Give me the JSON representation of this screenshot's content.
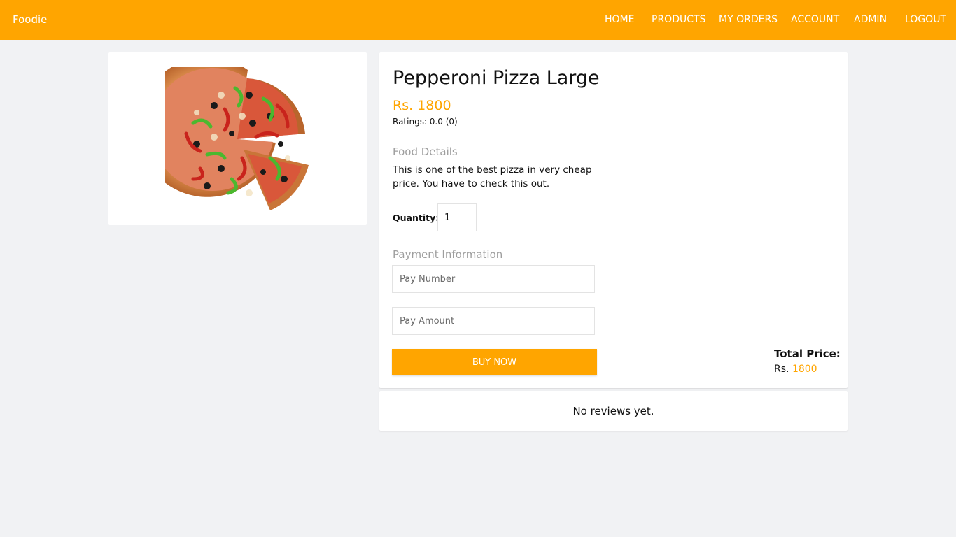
{
  "navbar": {
    "brand": "Foodie",
    "links": [
      "HOME",
      "PRODUCTS",
      "MY ORDERS",
      "ACCOUNT",
      "ADMIN",
      "LOGOUT"
    ]
  },
  "product": {
    "image_icon": "pizza-image",
    "title": "Pepperoni Pizza Large",
    "price": "Rs. 1800",
    "ratings": "Ratings: 0.0 (0)"
  },
  "details": {
    "heading": "Food Details",
    "description": "This is one of the best pizza in very cheap price. You have to check this out."
  },
  "quantity": {
    "label": "Quantity:",
    "value": "1"
  },
  "payment": {
    "heading": "Payment Information",
    "pay_number_placeholder": "Pay Number",
    "pay_amount_placeholder": "Pay Amount",
    "buy_label": "BUY NOW"
  },
  "total": {
    "label": "Total Price:",
    "currency": "Rs.",
    "amount": "1800"
  },
  "reviews": {
    "empty_text": "No reviews yet."
  },
  "colors": {
    "accent": "#ffa500",
    "background": "#f1f2f4",
    "muted": "#9e9e9e"
  }
}
